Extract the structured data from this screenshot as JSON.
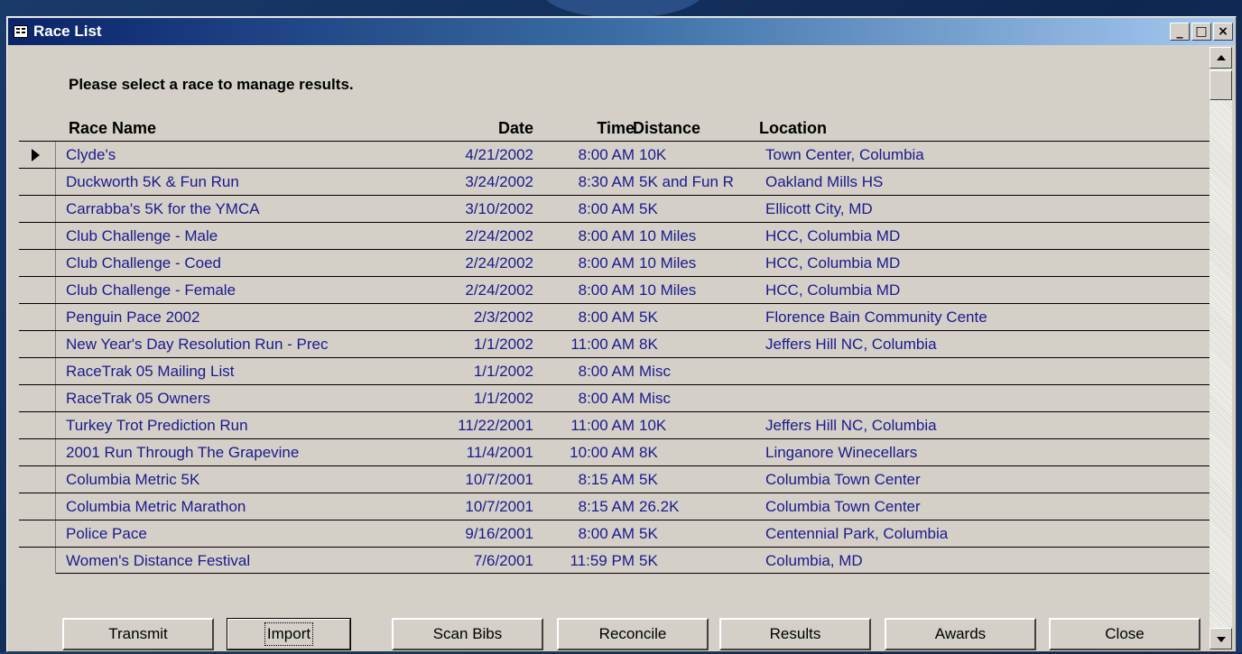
{
  "window": {
    "title": "Race List",
    "controls": {
      "minimize": "_",
      "maximize": "□",
      "close": "×"
    }
  },
  "prompt": "Please select a race to manage results.",
  "columns": {
    "name": "Race Name",
    "date": "Date",
    "time": "Time",
    "distance": "Distance",
    "location": "Location"
  },
  "rows": [
    {
      "name": "Clyde's",
      "date": "4/21/2002",
      "time": "8:00 AM",
      "distance": "10K",
      "location": "Town Center, Columbia"
    },
    {
      "name": "Duckworth 5K & Fun Run",
      "date": "3/24/2002",
      "time": "8:30 AM",
      "distance": "5K and Fun R",
      "location": "Oakland Mills HS"
    },
    {
      "name": "Carrabba's 5K for the YMCA",
      "date": "3/10/2002",
      "time": "8:00 AM",
      "distance": "5K",
      "location": "Ellicott City, MD"
    },
    {
      "name": "Club Challenge - Male",
      "date": "2/24/2002",
      "time": "8:00 AM",
      "distance": "10 Miles",
      "location": "HCC, Columbia MD"
    },
    {
      "name": "Club Challenge - Coed",
      "date": "2/24/2002",
      "time": "8:00 AM",
      "distance": "10 Miles",
      "location": "HCC, Columbia MD"
    },
    {
      "name": "Club Challenge - Female",
      "date": "2/24/2002",
      "time": "8:00 AM",
      "distance": "10 Miles",
      "location": "HCC, Columbia MD"
    },
    {
      "name": "Penguin Pace 2002",
      "date": "2/3/2002",
      "time": "8:00 AM",
      "distance": "5K",
      "location": "Florence Bain Community Cente"
    },
    {
      "name": "New Year's Day Resolution Run - Prec",
      "date": "1/1/2002",
      "time": "11:00 AM",
      "distance": "8K",
      "location": "Jeffers Hill NC, Columbia"
    },
    {
      "name": "RaceTrak 05 Mailing List",
      "date": "1/1/2002",
      "time": "8:00 AM",
      "distance": "Misc",
      "location": ""
    },
    {
      "name": "RaceTrak 05 Owners",
      "date": "1/1/2002",
      "time": "8:00 AM",
      "distance": "Misc",
      "location": ""
    },
    {
      "name": "Turkey Trot Prediction Run",
      "date": "11/22/2001",
      "time": "11:00 AM",
      "distance": "10K",
      "location": "Jeffers Hill NC, Columbia"
    },
    {
      "name": "2001 Run Through The Grapevine",
      "date": "11/4/2001",
      "time": "10:00 AM",
      "distance": "8K",
      "location": "Linganore Winecellars"
    },
    {
      "name": "Columbia Metric 5K",
      "date": "10/7/2001",
      "time": "8:15 AM",
      "distance": "5K",
      "location": "Columbia Town Center"
    },
    {
      "name": "Columbia Metric Marathon",
      "date": "10/7/2001",
      "time": "8:15 AM",
      "distance": "26.2K",
      "location": "Columbia Town Center"
    },
    {
      "name": "Police Pace",
      "date": "9/16/2001",
      "time": "8:00 AM",
      "distance": "5K",
      "location": "Centennial Park, Columbia"
    },
    {
      "name": "Women's Distance Festival",
      "date": "7/6/2001",
      "time": "11:59 PM",
      "distance": "5K",
      "location": "Columbia, MD"
    }
  ],
  "buttons": {
    "transmit": "Transmit",
    "import": "Import",
    "scan_bibs": "Scan Bibs",
    "reconcile": "Reconcile",
    "results": "Results",
    "awards": "Awards",
    "close": "Close"
  }
}
